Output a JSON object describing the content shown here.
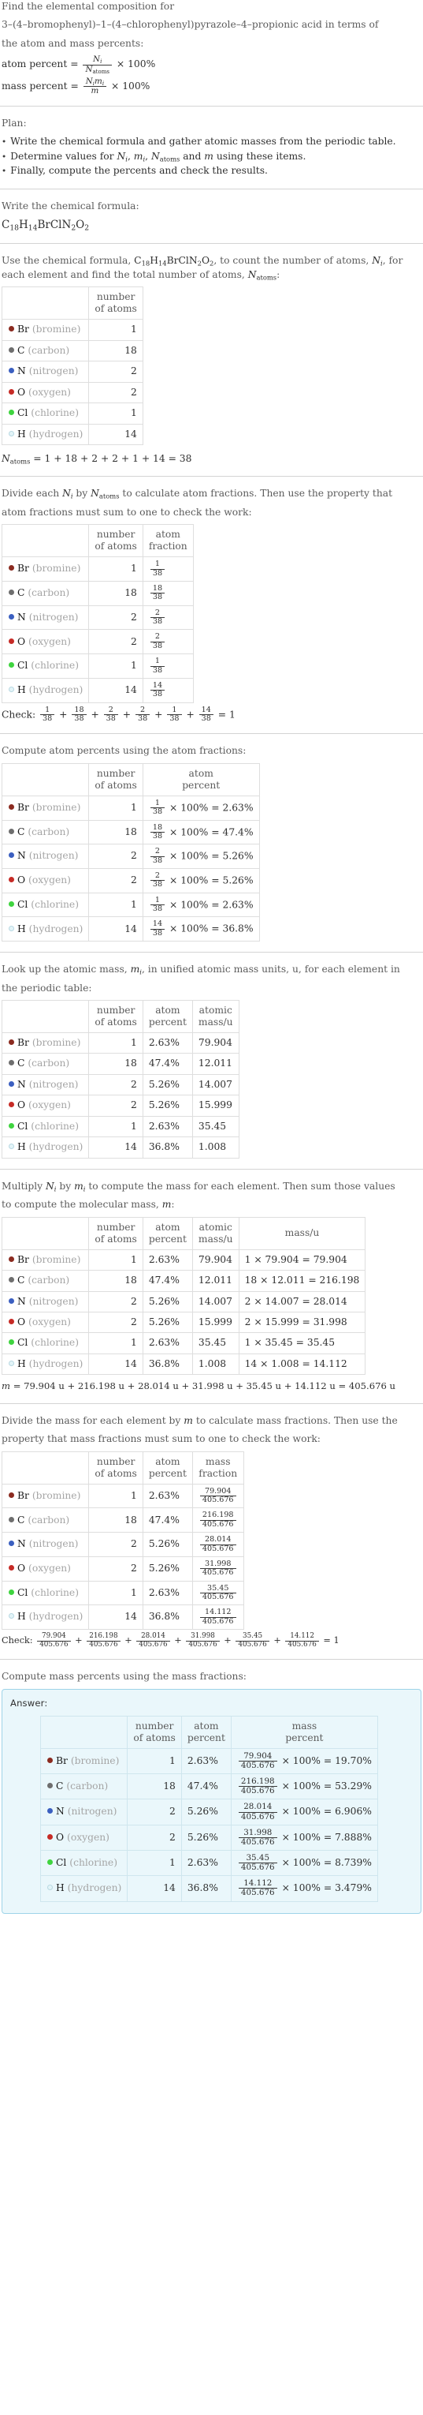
{
  "problem": {
    "intro_line1": "Find the elemental composition for",
    "intro_line2": "3–(4–bromophenyl)–1–(4–chlorophenyl)pyrazole–4–propionic acid in terms of",
    "intro_line3": "the atom and mass percents:",
    "atom_percent_label": "atom percent =",
    "mass_percent_label": "mass percent =",
    "atom_percent_num": "N",
    "atom_percent_num_sub": "i",
    "atom_percent_den": "N",
    "atom_percent_den_sub": "atoms",
    "mass_percent_num": "N",
    "mass_percent_num_sub": "i",
    "mass_percent_num2": "m",
    "mass_percent_num2_sub": "i",
    "mass_percent_den": "m",
    "times_100": "× 100%"
  },
  "plan": {
    "heading": "Plan:",
    "items": [
      "Write the chemical formula and gather atomic masses from the periodic table.",
      "Determine values for Ni, mi, Natoms and m using these items.",
      "Finally, compute the percents and check the results."
    ],
    "item2_parts": {
      "a": "Determine values for ",
      "b": " and ",
      "c": " using these items."
    }
  },
  "formula_section": {
    "heading": "Write the chemical formula:",
    "formula_plain": "C18H14BrClN2O2",
    "formula_parts": [
      {
        "sym": "C",
        "sub": "18"
      },
      {
        "sym": "H",
        "sub": "14"
      },
      {
        "sym": "Br",
        "sub": ""
      },
      {
        "sym": "Cl",
        "sub": ""
      },
      {
        "sym": "N",
        "sub": "2"
      },
      {
        "sym": "O",
        "sub": "2"
      }
    ]
  },
  "count_section": {
    "text_a": "Use the chemical formula, ",
    "text_b": ", to count the number of atoms, ",
    "text_c": ", for each element and find the total number of atoms, ",
    "text_d": ":",
    "headers": [
      "",
      "number of atoms"
    ],
    "header_lines": [
      [
        "number",
        "of atoms"
      ]
    ],
    "total_line": "Natoms = 1 + 18 + 2 + 2 + 1 + 14 = 38",
    "total_expr": "= 1 + 18 + 2 + 2 + 1 + 14 = 38"
  },
  "elements": [
    {
      "symbol": "Br",
      "name": "(bromine)",
      "color": "#8b2b20",
      "filled": true,
      "count": "1",
      "atom_fraction_num": "1",
      "atom_fraction_den": "38",
      "atom_percent": "2.63%",
      "atomic_mass": "79.904",
      "mass_expr": "1 × 79.904 = 79.904",
      "mass_value": "79.904",
      "mass_percent": "19.70%"
    },
    {
      "symbol": "C",
      "name": "(carbon)",
      "color": "#6e6e6e",
      "filled": true,
      "count": "18",
      "atom_fraction_num": "18",
      "atom_fraction_den": "38",
      "atom_percent": "47.4%",
      "atomic_mass": "12.011",
      "mass_expr": "18 × 12.011 = 216.198",
      "mass_value": "216.198",
      "mass_percent": "53.29%"
    },
    {
      "symbol": "N",
      "name": "(nitrogen)",
      "color": "#3b5fc0",
      "filled": true,
      "count": "2",
      "atom_fraction_num": "2",
      "atom_fraction_den": "38",
      "atom_percent": "5.26%",
      "atomic_mass": "14.007",
      "mass_expr": "2 × 14.007 = 28.014",
      "mass_value": "28.014",
      "mass_percent": "6.906%"
    },
    {
      "symbol": "O",
      "name": "(oxygen)",
      "color": "#c62b26",
      "filled": true,
      "count": "2",
      "atom_fraction_num": "2",
      "atom_fraction_den": "38",
      "atom_percent": "5.26%",
      "atomic_mass": "15.999",
      "mass_expr": "2 × 15.999 = 31.998",
      "mass_value": "31.998",
      "mass_percent": "7.888%"
    },
    {
      "symbol": "Cl",
      "name": "(chlorine)",
      "color": "#3fd43f",
      "filled": true,
      "count": "1",
      "atom_fraction_num": "1",
      "atom_fraction_den": "38",
      "atom_percent": "2.63%",
      "atomic_mass": "35.45",
      "mass_expr": "1 × 35.45 = 35.45",
      "mass_value": "35.45",
      "mass_percent": "8.739%"
    },
    {
      "symbol": "H",
      "name": "(hydrogen)",
      "color": "#e3f4f8",
      "filled": false,
      "count": "14",
      "atom_fraction_num": "14",
      "atom_fraction_den": "38",
      "atom_percent": "36.8%",
      "atomic_mass": "1.008",
      "mass_expr": "14 × 1.008 = 14.112",
      "mass_value": "14.112",
      "mass_percent": "3.479%"
    }
  ],
  "atom_fraction_section": {
    "text_a": "Divide each ",
    "text_b": " by ",
    "text_c": " to calculate atom fractions. Then use the property that",
    "text_d": "atom fractions must sum to one to check the work:",
    "col_atoms": [
      "number",
      "of atoms"
    ],
    "col_fraction": [
      "atom",
      "fraction"
    ],
    "check_label": "Check:",
    "check_result": "= 1"
  },
  "atom_percent_section": {
    "text": "Compute atom percents using the atom fractions:",
    "col_atoms": [
      "number",
      "of atoms"
    ],
    "col_percent": [
      "atom",
      "percent"
    ],
    "times": "× 100% ="
  },
  "atomic_mass_section": {
    "text_a": "Look up the atomic mass, ",
    "text_b": ", in unified atomic mass units, u, for each element in",
    "text_c": "the periodic table:",
    "col_atoms": [
      "number",
      "of atoms"
    ],
    "col_percent": [
      "atom",
      "percent"
    ],
    "col_mass": [
      "atomic",
      "mass/u"
    ]
  },
  "multiply_section": {
    "text_a": "Multiply ",
    "text_b": " by ",
    "text_c": " to compute the mass for each element. Then sum those values",
    "text_d": "to compute the molecular mass, ",
    "text_e": ":",
    "col_atoms": [
      "number",
      "of atoms"
    ],
    "col_percent": [
      "atom",
      "percent"
    ],
    "col_atomic_mass": [
      "atomic",
      "mass/u"
    ],
    "col_mass": [
      "mass/u"
    ],
    "molecular_mass_line": "= 79.904 u + 216.198 u + 28.014 u + 31.998 u + 35.45 u + 14.112 u = 405.676 u",
    "molecular_mass_value": "405.676"
  },
  "mass_fraction_section": {
    "text_a": "Divide the mass for each element by ",
    "text_b": " to calculate mass fractions. Then use the",
    "text_c": "property that mass fractions must sum to one to check the work:",
    "col_atoms": [
      "number",
      "of atoms"
    ],
    "col_percent": [
      "atom",
      "percent"
    ],
    "col_fraction": [
      "mass",
      "fraction"
    ],
    "denominator": "405.676",
    "check_label": "Check:",
    "check_result": "= 1"
  },
  "mass_percent_section": {
    "text": "Compute mass percents using the mass fractions:",
    "answer_label": "Answer:",
    "col_atoms": [
      "number",
      "of atoms"
    ],
    "col_atom_percent": [
      "atom",
      "percent"
    ],
    "col_mass_percent": [
      "mass",
      "percent"
    ],
    "denominator": "405.676",
    "times": "× 100% ="
  },
  "colors": {
    "rule": "#d4d4d4",
    "answer_border": "#9ed4e8",
    "answer_bg": "#eaf7fb",
    "text": "#3b3b3b",
    "muted": "#a5a5a5"
  }
}
